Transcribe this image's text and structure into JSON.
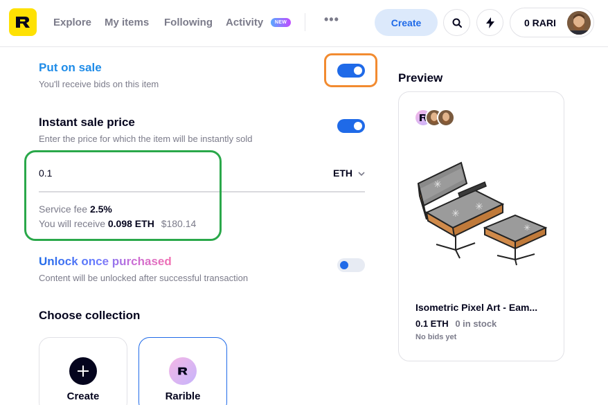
{
  "header": {
    "logo_letter": "R",
    "nav": [
      "Explore",
      "My items",
      "Following",
      "Activity"
    ],
    "new_badge": "NEW",
    "more": "•••",
    "create_label": "Create",
    "wallet_label": "0 RARI",
    "icons": {
      "search": "search-icon",
      "bolt": "lightning-icon"
    }
  },
  "form": {
    "put_on_sale": {
      "title": "Put on sale",
      "subtitle": "You'll receive bids on this item",
      "enabled": true
    },
    "instant_sale": {
      "title": "Instant sale price",
      "subtitle": "Enter the price for which the item will be instantly sold",
      "enabled": true
    },
    "price": {
      "value": "0.1",
      "currency": "ETH"
    },
    "fee": {
      "label": "Service fee",
      "value": "2.5%"
    },
    "receive": {
      "label": "You will receive",
      "amount": "0.098 ETH",
      "usd": "$180.14"
    },
    "unlock": {
      "title": "Unlock once purchased",
      "subtitle": "Content will be unlocked after successful transaction",
      "enabled": false
    },
    "collection": {
      "title": "Choose collection",
      "options": [
        {
          "label": "Create",
          "icon": "plus-icon"
        },
        {
          "label": "Rarible",
          "icon": "rarible-logo"
        }
      ]
    }
  },
  "preview": {
    "title": "Preview",
    "item_name": "Isometric Pixel Art - Eam...",
    "price": "0.1 ETH",
    "stock": "0 in stock",
    "bids": "No bids yet"
  },
  "colors": {
    "accent": "#1f6ae8",
    "brand_yellow": "#fee103",
    "orange_highlight": "#f28b30",
    "green_highlight": "#2aa84a"
  }
}
